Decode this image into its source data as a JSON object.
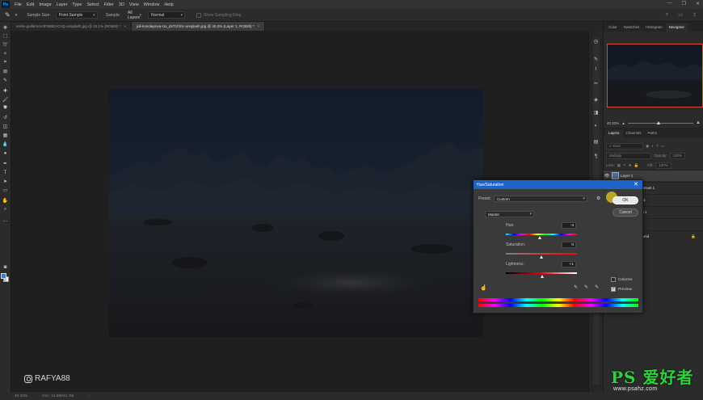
{
  "menubar": {
    "logo": "Ps",
    "items": [
      "File",
      "Edit",
      "Image",
      "Layer",
      "Type",
      "Select",
      "Filter",
      "3D",
      "View",
      "Window",
      "Help"
    ]
  },
  "options_bar": {
    "sample_size_label": "Sample Size:",
    "sample_size_value": "Point Sample",
    "sample_label": "Sample:",
    "sample_value": "All Layers",
    "mode_value": "Normal",
    "show_ring_label": "Show Sampling Ring"
  },
  "tabs": [
    {
      "label": "emile-guillemot-tIFWBEACcQ-unsplash.jpg @ 15.1% (RGB/8) *",
      "active": false
    },
    {
      "label": "juli-kosolapova-Ux_dvT1f1bc-unsplash.jpg @ 40.3% (Layer 1, RGB/8) *",
      "active": true
    }
  ],
  "status_bar": {
    "zoom": "40.33%",
    "doc": "Doc: 11.9M/31.7M"
  },
  "panels": {
    "top_tabs": [
      "Color",
      "Swatches",
      "Histogram",
      "Navigator"
    ],
    "active_top_tab": "Navigator",
    "nav_zoom": "40.33%",
    "layer_tabs": [
      "Layers",
      "Channels",
      "Paths"
    ],
    "active_layer_tab": "Layers",
    "kind_label": "Kind",
    "blend_mode": "Multiply",
    "opacity_label": "Opacity:",
    "opacity_value": "100%",
    "lock_label": "Lock:",
    "fill_label": "Fill:",
    "fill_value": "100%",
    "layers": [
      {
        "name": "Layer 1",
        "selected": true
      },
      {
        "name": "Brightness/Contrast 1",
        "selected": false
      },
      {
        "name": "Color Balance 1",
        "selected": false
      },
      {
        "name": "Hue/Saturation 1",
        "selected": false
      },
      {
        "name": "Levels 1",
        "selected": false
      },
      {
        "name": "ound",
        "selected": false
      }
    ]
  },
  "dialog": {
    "title": "Hue/Saturation",
    "preset_label": "Preset:",
    "preset_value": "Custom",
    "channel": "Master",
    "ok": "OK",
    "cancel": "Cancel",
    "hue_label": "Hue:",
    "hue_value": "-4",
    "saturation_label": "Saturation:",
    "saturation_value": "0",
    "lightness_label": "Lightness:",
    "lightness_value": "+1",
    "colorize_label": "Colorize",
    "colorize_checked": false,
    "preview_label": "Preview",
    "preview_checked": true
  },
  "watermarks": {
    "instagram_handle": "RAFYA88",
    "ps_brand": "PS 爱好者",
    "ps_site": "www.psahz.com"
  },
  "colors": {
    "accent_blue": "#1e64c8",
    "navigator_frame": "#e0463c",
    "watermark_green": "#2fd23c",
    "foreground_swatch": "#3a7bd5"
  }
}
